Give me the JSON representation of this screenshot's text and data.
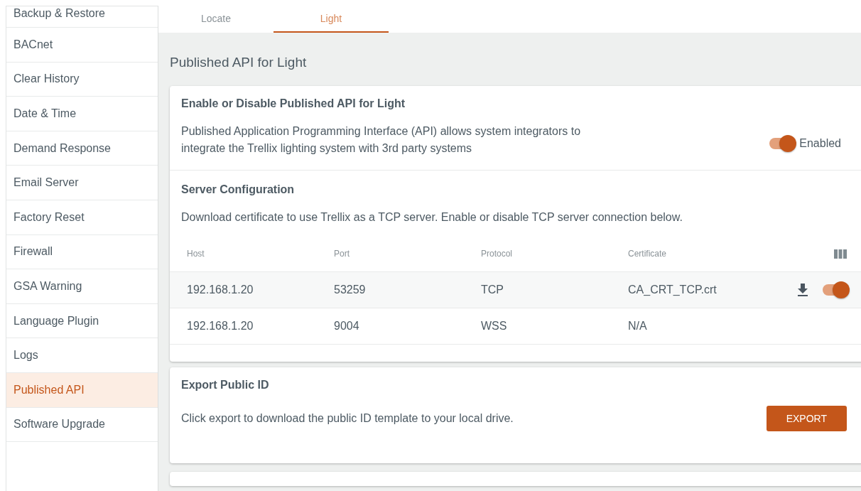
{
  "sidebar": {
    "items": [
      {
        "label": "Backup & Restore",
        "selected": false
      },
      {
        "label": "BACnet",
        "selected": false
      },
      {
        "label": "Clear History",
        "selected": false
      },
      {
        "label": "Date & Time",
        "selected": false
      },
      {
        "label": "Demand Response",
        "selected": false
      },
      {
        "label": "Email Server",
        "selected": false
      },
      {
        "label": "Factory Reset",
        "selected": false
      },
      {
        "label": "Firewall",
        "selected": false
      },
      {
        "label": "GSA Warning",
        "selected": false
      },
      {
        "label": "Language Plugin",
        "selected": false
      },
      {
        "label": "Logs",
        "selected": false
      },
      {
        "label": "Published API",
        "selected": true
      },
      {
        "label": "Software Upgrade",
        "selected": false
      }
    ]
  },
  "tabs": [
    {
      "label": "Locate",
      "selected": false
    },
    {
      "label": "Light",
      "selected": true
    }
  ],
  "page_title": "Published API for Light",
  "enable_card": {
    "title": "Enable or Disable Published API for Light",
    "description": "Published Application Programming Interface (API) allows system integrators to integrate the Trellix lighting system with 3rd party systems",
    "toggle_on": true,
    "toggle_label": "Enabled"
  },
  "server_card": {
    "title": "Server Configuration",
    "description": "Download certificate to use Trellix as a TCP server. Enable or disable TCP server connection below.",
    "columns": [
      "Host",
      "Port",
      "Protocol",
      "Certificate"
    ],
    "rows": [
      {
        "host": "192.168.1.20",
        "port": "53259",
        "protocol": "TCP",
        "certificate": "CA_CRT_TCP.crt",
        "actions": true,
        "toggle_on": true
      },
      {
        "host": "192.168.1.20",
        "port": "9004",
        "protocol": "WSS",
        "certificate": "N/A",
        "actions": false
      }
    ]
  },
  "export_card": {
    "title": "Export Public ID",
    "description": "Click export to download the public ID template to your local drive.",
    "button": "EXPORT"
  }
}
